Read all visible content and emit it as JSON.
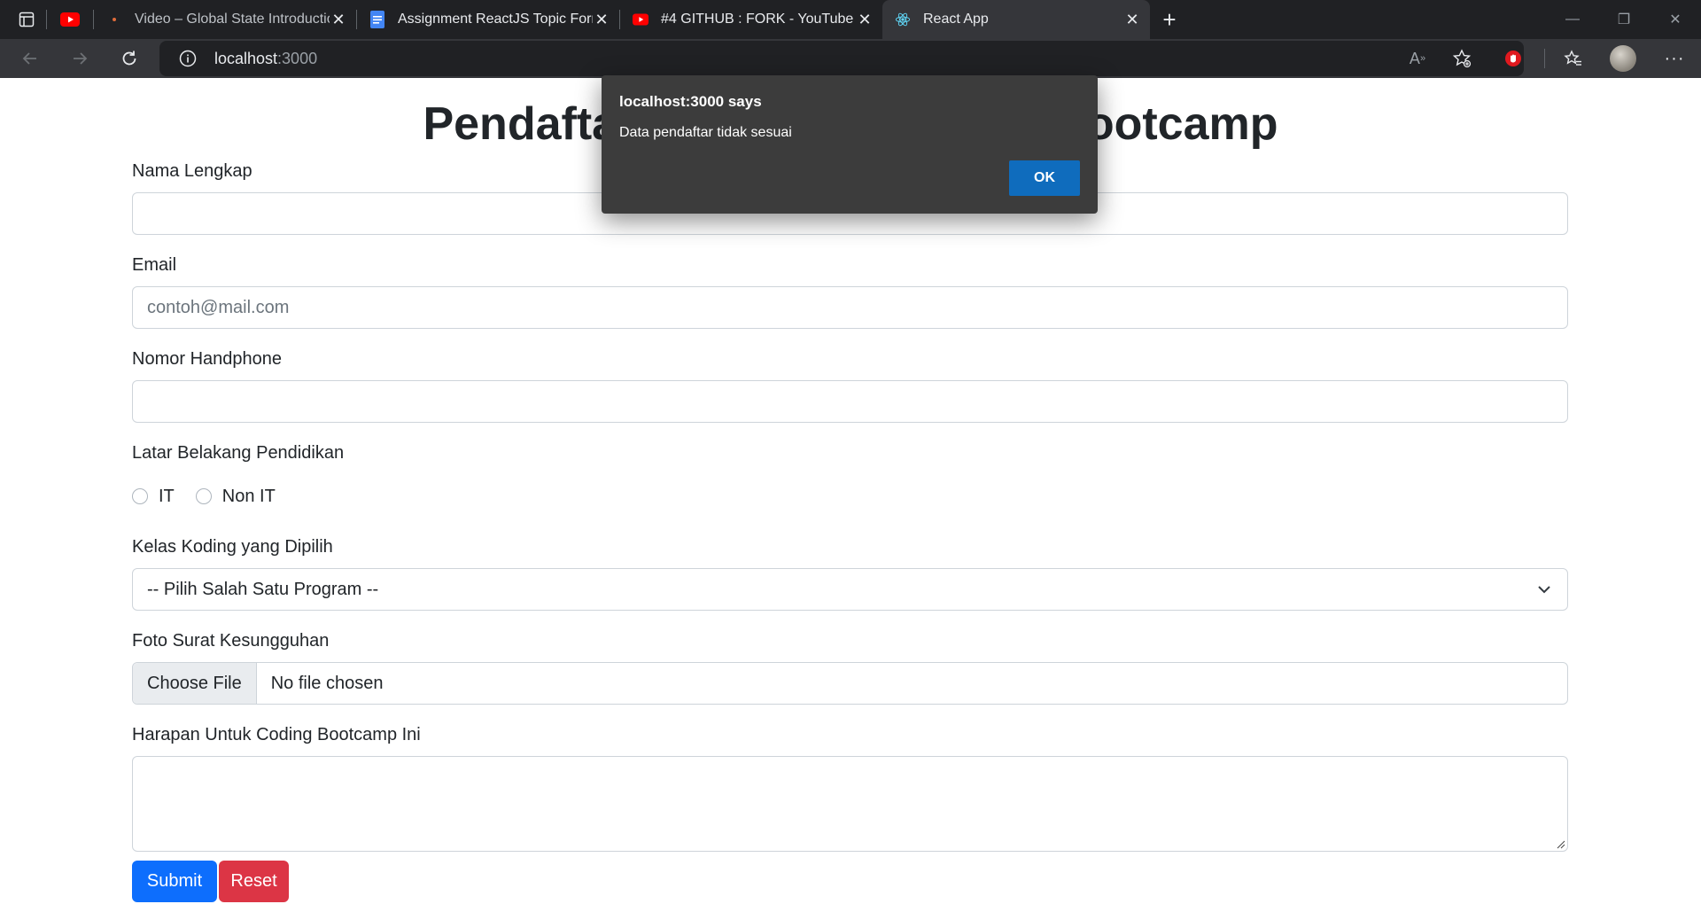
{
  "browser": {
    "tabs": [
      {
        "title": "Video – Global State Introduction",
        "icon": "video-dot-icon"
      },
      {
        "title": "Assignment ReactJS Topic Form",
        "icon": "google-docs-icon"
      },
      {
        "title": "#4 GITHUB : FORK - YouTube",
        "icon": "youtube-icon"
      },
      {
        "title": "React App",
        "icon": "react-icon",
        "active": true
      }
    ],
    "address": {
      "host": "localhost",
      "port": ":3000"
    }
  },
  "page": {
    "title": "Pendaftaran Peserta Coding Bootcamp",
    "fields": {
      "name_label": "Nama Lengkap",
      "email_label": "Email",
      "email_placeholder": "contoh@mail.com",
      "phone_label": "Nomor Handphone",
      "education_label": "Latar Belakang Pendidikan",
      "radio_it": "IT",
      "radio_non_it": "Non IT",
      "class_label": "Kelas Koding yang Dipilih",
      "class_selected": "-- Pilih Salah Satu Program --",
      "photo_label": "Foto Surat Kesungguhan",
      "file_button": "Choose File",
      "file_status": "No file chosen",
      "hope_label": "Harapan Untuk Coding Bootcamp Ini"
    },
    "buttons": {
      "submit": "Submit",
      "reset": "Reset"
    }
  },
  "dialog": {
    "title": "localhost:3000 says",
    "message": "Data pendaftar tidak sesuai",
    "ok": "OK"
  },
  "colors": {
    "primary": "#0d6efd",
    "danger": "#dc3545",
    "dialog_bg": "#3c3c3c",
    "dialog_ok": "#0f6cbd"
  }
}
